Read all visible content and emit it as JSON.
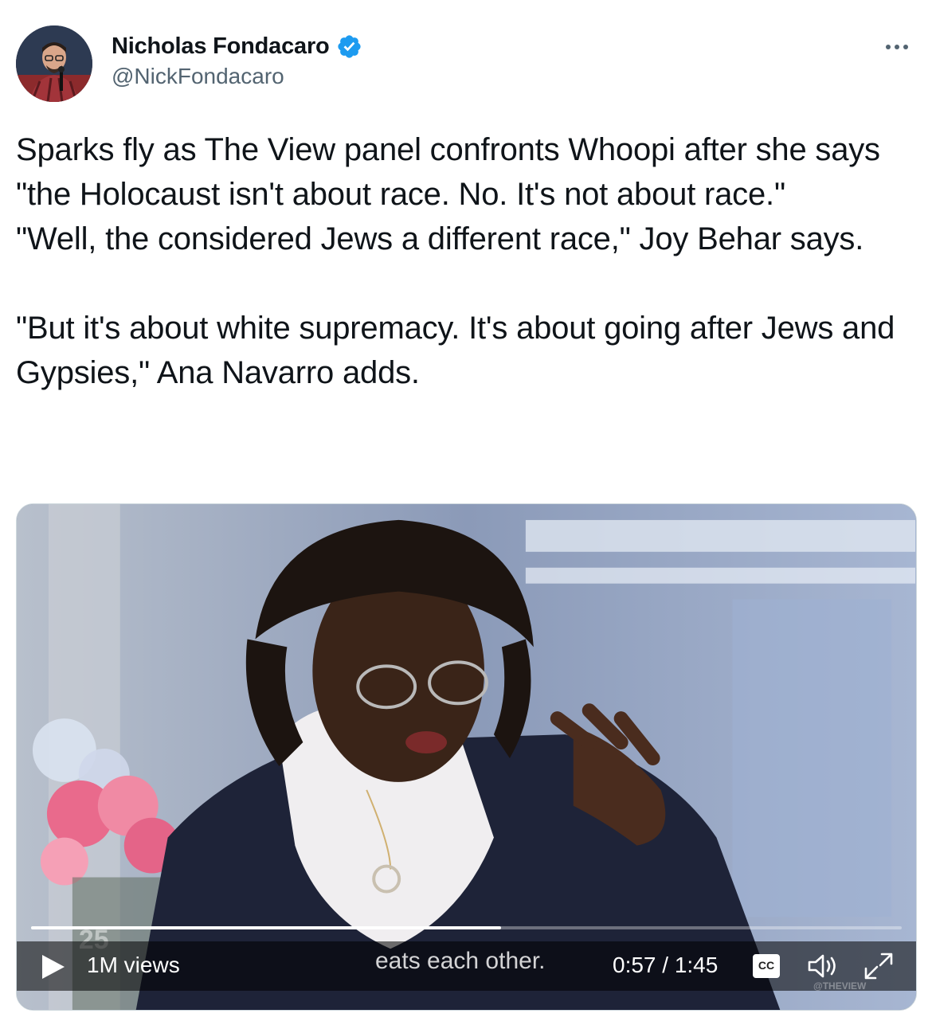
{
  "author": {
    "display_name": "Nicholas Fondacaro",
    "handle": "@NickFondacaro",
    "verified": true
  },
  "tweet": {
    "paragraphs": [
      "Sparks fly as The View panel confronts Whoopi after she says \"the Holocaust isn't about race. No. It's not about race.\"",
      "\"Well, the considered Jews a different race,\" Joy Behar says.",
      "\"But it's about white supremacy. It's about going after Jews and Gypsies,\" Ana Navarro adds."
    ]
  },
  "video": {
    "views": "1M views",
    "caption": "eats each other.",
    "time": "0:57 / 1:45",
    "progress_fraction": 0.54,
    "cc_label": "CC",
    "watermark": "@THEVIEW"
  },
  "icons": {
    "more": "more-horizontal-icon",
    "verified": "verified-badge-icon",
    "play": "play-icon",
    "cc": "closed-captions-icon",
    "volume": "volume-icon",
    "fullscreen": "fullscreen-icon"
  },
  "colors": {
    "verified": "#1d9bf0",
    "text": "#0f1419",
    "secondary": "#536471"
  }
}
